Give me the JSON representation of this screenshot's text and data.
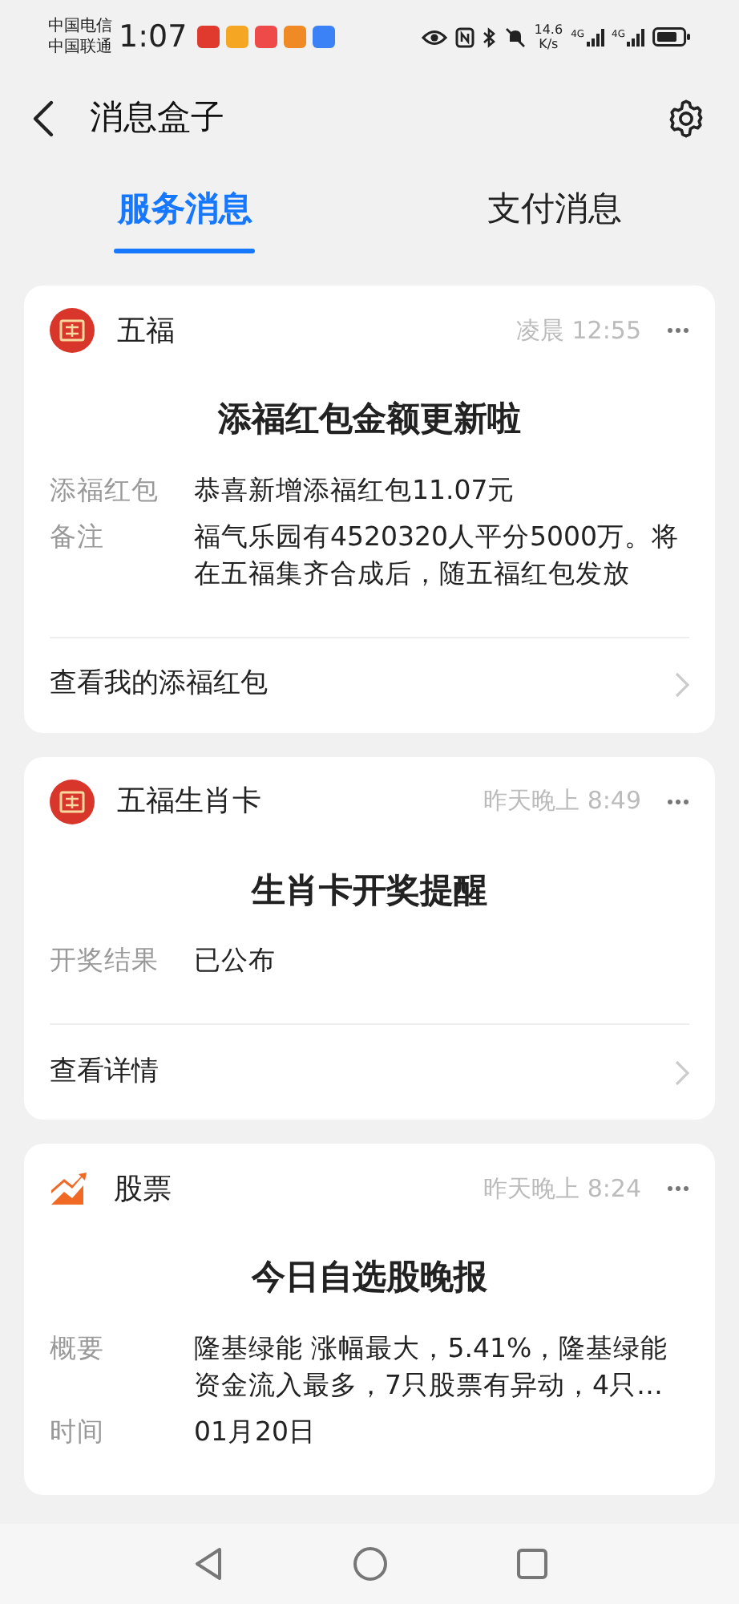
{
  "status_bar": {
    "carriers": [
      "中国电信",
      "中国联通"
    ],
    "time": "1:07",
    "speed": "14.6",
    "speed_unit": "K/s",
    "networks": [
      "4G",
      "4G"
    ]
  },
  "header": {
    "title": "消息盒子"
  },
  "tabs": [
    {
      "label": "服务消息",
      "selected": true
    },
    {
      "label": "支付消息",
      "selected": false
    }
  ],
  "cards": [
    {
      "kind": "wufu",
      "name": "五福",
      "time": "凌晨 12:55",
      "title": "添福红包金额更新啦",
      "rows": [
        {
          "label": "添福红包",
          "value": "恭喜新增添福红包11.07元"
        },
        {
          "label": "备注",
          "value": "福气乐园有4520320人平分5000万。将在五福集齐合成后，随五福红包发放"
        }
      ],
      "link": "查看我的添福红包"
    },
    {
      "kind": "wufu",
      "name": "五福生肖卡",
      "time": "昨天晚上 8:49",
      "title": "生肖卡开奖提醒",
      "rows": [
        {
          "label": "开奖结果",
          "value": "已公布"
        }
      ],
      "link": "查看详情"
    },
    {
      "kind": "stock",
      "name": "股票",
      "time": "昨天晚上 8:24",
      "title": "今日自选股晚报",
      "rows": [
        {
          "label": "概要",
          "value": "隆基绿能 涨幅最大，5.41%，隆基绿能资金流入最多，7只股票有异动，4只…"
        },
        {
          "label": "时间",
          "value": "01月20日"
        }
      ]
    }
  ]
}
